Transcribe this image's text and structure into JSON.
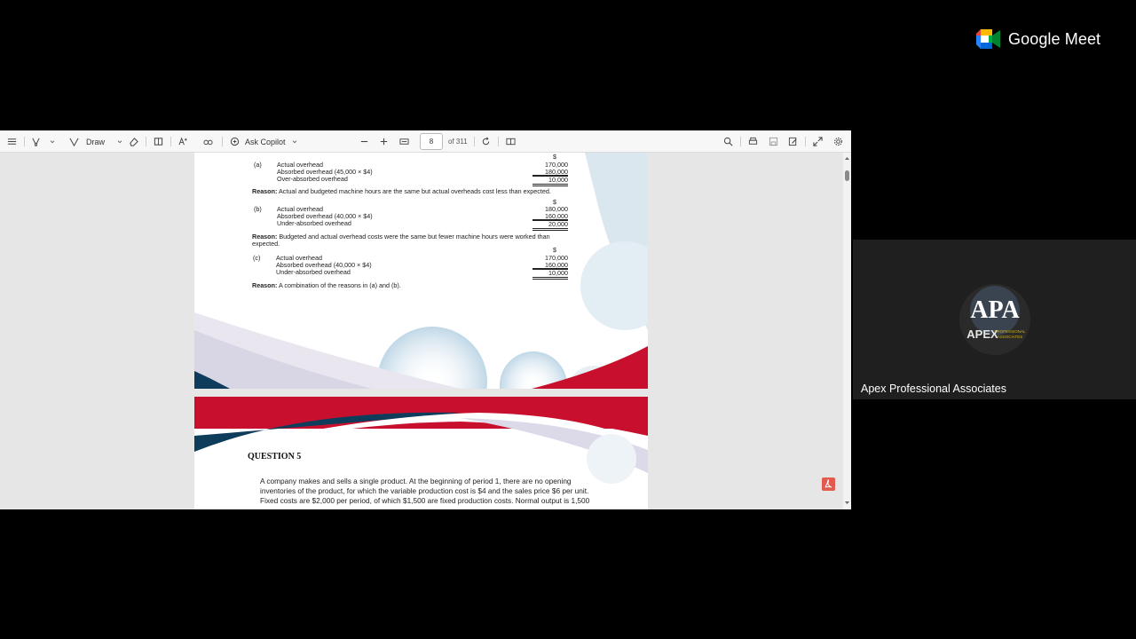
{
  "toolbar": {
    "draw_label": "Draw",
    "ask_copilot_label": "Ask Copilot",
    "page_current": "8",
    "page_total": "of 311"
  },
  "page1": {
    "a": {
      "currency": "$",
      "letter": "(a)",
      "lines": [
        "Actual overhead",
        "Absorbed overhead (45,000 × $4)",
        "Over-absorbed overhead"
      ],
      "values": [
        "170,000",
        "180,000",
        "10,000"
      ],
      "reason_label": "Reason:",
      "reason": "Actual and budgeted machine hours are the same but actual overheads cost less than expected."
    },
    "b": {
      "currency": "$",
      "letter": "(b)",
      "lines": [
        "Actual overhead",
        "Absorbed overhead (40,000 × $4)",
        "Under-absorbed overhead"
      ],
      "values": [
        "180,000",
        "160,000",
        "20,000"
      ],
      "reason_label": "Reason:",
      "reason_line1": "Budgeted and actual overhead costs were the same but fewer machine hours were worked than",
      "reason_line2": "expected."
    },
    "c": {
      "currency": "$",
      "letter": "(c)",
      "lines": [
        "Actual overhead",
        "Absorbed overhead (40,000 × $4)",
        "Under-absorbed overhead"
      ],
      "values": [
        "170,000",
        "160,000",
        "10,000"
      ],
      "reason_label": "Reason:",
      "reason": "A combination of the reasons in (a) and (b)."
    }
  },
  "page2": {
    "title": "QUESTION 5",
    "body_line1": "A company makes and sells a single product. At the beginning of period 1, there are no opening",
    "body_line2": "inventories of the product, for which the variable production cost is $4 and the sales price $6 per unit.",
    "body_line3": "Fixed costs are $2,000 per period, of which $1,500 are fixed production costs. Normal output is 1,500"
  },
  "meet": {
    "brand": "Google Meet",
    "participant_name": "Apex Professional Associates",
    "avatar_initials": "APA",
    "avatar_word": "APEX",
    "avatar_sub1": "PROFESSIONAL",
    "avatar_sub2": "ASSOCIATES"
  },
  "colors": {
    "brand_red": "#c8102e",
    "brand_navy": "#0e3d5c",
    "meet_tile": "#1f1f1f"
  }
}
